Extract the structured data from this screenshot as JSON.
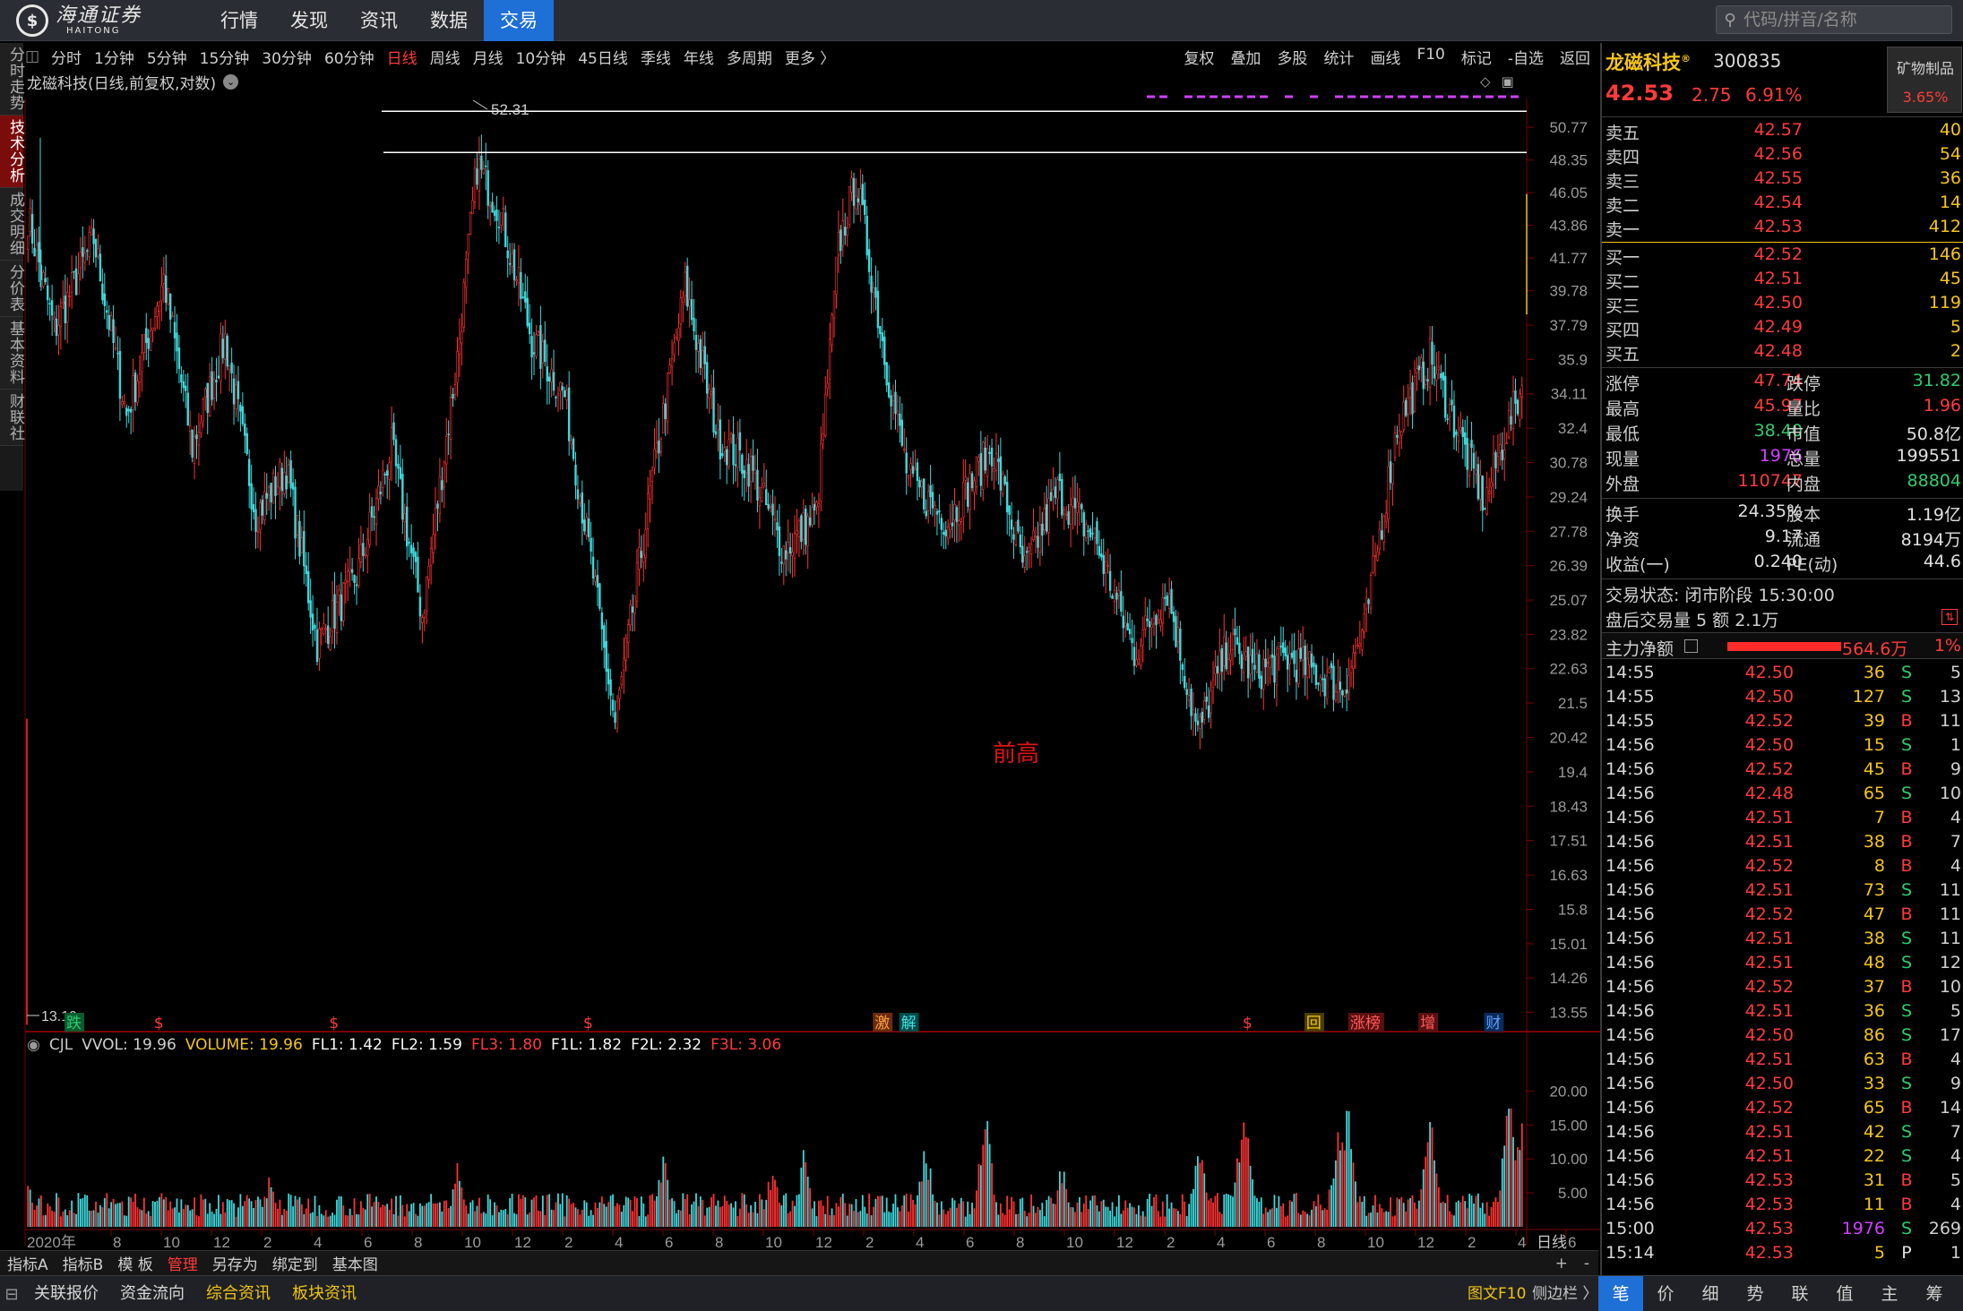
{
  "app": {
    "logo_text": "海通证券",
    "logo_sub": "HAITONG",
    "menu": [
      "行情",
      "发现",
      "资讯",
      "数据",
      "交易"
    ],
    "menu_active": 4,
    "search_placeholder": "代码/拼音/名称"
  },
  "left_tabs": [
    "分时走势",
    "技术分析",
    "成交明细",
    "分价表",
    "基本资料",
    "财联社"
  ],
  "left_tab_active": 1,
  "periods": [
    "分时",
    "1分钟",
    "5分钟",
    "15分钟",
    "30分钟",
    "60分钟",
    "日线",
    "周线",
    "月线",
    "10分钟",
    "45日线",
    "季线",
    "年线",
    "多周期",
    "更多 〉"
  ],
  "period_active": 6,
  "toolbar_right": [
    "复权",
    "叠加",
    "多股",
    "统计",
    "画线",
    "F10",
    "标记",
    "-自选",
    "返回"
  ],
  "chart_title": "龙磁科技(日线,前复权,对数)",
  "chart_tools": [
    "◇",
    "▣"
  ],
  "indicator": {
    "name": "CJL",
    "items": [
      {
        "label": "VVOL: 19.96",
        "color": "#d0d0d0"
      },
      {
        "label": "VOLUME: 19.96",
        "color": "#f5c518"
      },
      {
        "label": "FL1: 1.42",
        "color": "#f5f5f5"
      },
      {
        "label": "FL2: 1.59",
        "color": "#f5f5f5"
      },
      {
        "label": "FL3: 1.80",
        "color": "#ff3b3b"
      },
      {
        "label": "F1L: 1.82",
        "color": "#f5f5f5"
      },
      {
        "label": "F2L: 2.32",
        "color": "#f5f5f5"
      },
      {
        "label": "F3L: 3.06",
        "color": "#ff3b3b"
      }
    ]
  },
  "xaxis_label": "日线",
  "bottom_tools": [
    "指标A",
    "指标B",
    "模 板",
    "管理",
    "另存为",
    "绑定到",
    "基本图"
  ],
  "bottom_tools_active": 3,
  "bottom_tools_right": [
    "+",
    "-"
  ],
  "bottom_tabs": [
    "关联报价",
    "资金流向",
    "综合资讯",
    "板块资讯"
  ],
  "bottom_tabs_yellow": [
    2,
    3
  ],
  "f10_label": "图文F10",
  "sidebar_label": "侧边栏 〉",
  "right_tabs": [
    "笔",
    "价",
    "细",
    "势",
    "联",
    "值",
    "主",
    "筹"
  ],
  "right_tab_active": 0,
  "chart_data": {
    "type": "candlestick",
    "title": "龙磁科技(日线,前复权,对数)",
    "y_scale": "log",
    "ylim": [
      13.2,
      53.0
    ],
    "y_ticks": [
      50.77,
      48.35,
      46.05,
      43.86,
      41.77,
      39.78,
      37.79,
      35.9,
      34.11,
      32.4,
      30.78,
      29.24,
      27.78,
      26.39,
      25.07,
      23.82,
      22.63,
      21.5,
      20.42,
      19.4,
      18.43,
      17.51,
      16.63,
      15.8,
      15.01,
      14.26,
      13.55
    ],
    "x_ticks": [
      "2020年",
      "8",
      "10",
      "12",
      "2",
      "4",
      "6",
      "8",
      "10",
      "12",
      "2",
      "4",
      "6",
      "8",
      "10",
      "12",
      "2",
      "4",
      "6",
      "8",
      "10",
      "12",
      "2",
      "4",
      "6",
      "8",
      "10",
      "12",
      "2",
      "4",
      "6"
    ],
    "high_label": "52.31",
    "low_label": "13.19",
    "annotation": "前高",
    "hlines": [
      52.0,
      48.9
    ],
    "price_path": [
      [
        0,
        44.5
      ],
      [
        12,
        37.5
      ],
      [
        30,
        43.0
      ],
      [
        45,
        33.0
      ],
      [
        62,
        40.5
      ],
      [
        75,
        31.5
      ],
      [
        90,
        37.0
      ],
      [
        104,
        28.5
      ],
      [
        118,
        30.5
      ],
      [
        132,
        23.5
      ],
      [
        150,
        26.0
      ],
      [
        166,
        31.5
      ],
      [
        180,
        24.5
      ],
      [
        196,
        36.0
      ],
      [
        205,
        48.0
      ],
      [
        215,
        45.0
      ],
      [
        230,
        37.0
      ],
      [
        245,
        34.0
      ],
      [
        258,
        26.0
      ],
      [
        268,
        20.8
      ],
      [
        285,
        30.0
      ],
      [
        300,
        40.0
      ],
      [
        315,
        32.0
      ],
      [
        330,
        30.5
      ],
      [
        345,
        27.0
      ],
      [
        360,
        28.5
      ],
      [
        370,
        42.5
      ],
      [
        378,
        47.0
      ],
      [
        392,
        35.5
      ],
      [
        402,
        30.0
      ],
      [
        420,
        28.2
      ],
      [
        440,
        31.5
      ],
      [
        455,
        26.2
      ],
      [
        470,
        29.5
      ],
      [
        487,
        27.5
      ],
      [
        505,
        23.2
      ],
      [
        520,
        25.5
      ],
      [
        534,
        20.5
      ],
      [
        548,
        23.5
      ],
      [
        560,
        22.5
      ],
      [
        575,
        23.0
      ],
      [
        588,
        22.5
      ],
      [
        600,
        22.0
      ],
      [
        610,
        24.0
      ],
      [
        625,
        32.5
      ],
      [
        640,
        36.0
      ],
      [
        652,
        32.5
      ],
      [
        665,
        29.0
      ],
      [
        674,
        32.0
      ],
      [
        682,
        34.5
      ]
    ],
    "volume_axis": [
      20.0,
      15.0,
      10.0,
      5.0
    ],
    "volume_spikes": [
      [
        0,
        7.5
      ],
      [
        60,
        6.5
      ],
      [
        110,
        8.0
      ],
      [
        196,
        10.0
      ],
      [
        290,
        12.0
      ],
      [
        340,
        10.0
      ],
      [
        354,
        11.5
      ],
      [
        410,
        13.5
      ],
      [
        437,
        19.0
      ],
      [
        472,
        10.0
      ],
      [
        535,
        14.0
      ],
      [
        555,
        22.0
      ],
      [
        598,
        17.0
      ],
      [
        602,
        22.5
      ],
      [
        640,
        18.0
      ],
      [
        676,
        21.0
      ],
      [
        682,
        18.5
      ]
    ],
    "markers": [
      {
        "idx": 18,
        "label": "跌",
        "bg": "#0b5b2e",
        "color": "#2ecc71"
      },
      {
        "idx": 58,
        "label": "$",
        "bg": "",
        "color": "#ff3b3b"
      },
      {
        "idx": 138,
        "label": "$",
        "bg": "",
        "color": "#ff3b3b"
      },
      {
        "idx": 254,
        "label": "$",
        "bg": "",
        "color": "#ff3b3b"
      },
      {
        "idx": 387,
        "label": "激",
        "bg": "#6b2b10",
        "color": "#ffa040"
      },
      {
        "idx": 399,
        "label": "解",
        "bg": "#004a4a",
        "color": "#40e0e0"
      },
      {
        "idx": 555,
        "label": "$",
        "bg": "",
        "color": "#ff3b3b"
      },
      {
        "idx": 584,
        "label": "回",
        "bg": "#4a3c00",
        "color": "#f5c518"
      },
      {
        "idx": 604,
        "label": "涨榜",
        "bg": "#5a1010",
        "color": "#ff5a5a"
      },
      {
        "idx": 636,
        "label": "增",
        "bg": "#5a1010",
        "color": "#ff5a5a"
      },
      {
        "idx": 666,
        "label": "财",
        "bg": "#0a2a5a",
        "color": "#5aa0ff"
      }
    ]
  },
  "quote": {
    "name": "龙磁科技",
    "badge": "®",
    "code": "300835",
    "price": "42.53",
    "change": "2.75",
    "change_pct": "6.91%",
    "industry": "矿物制品",
    "industry_pct": "3.65%",
    "asks": [
      {
        "label": "卖五",
        "price": "42.57",
        "vol": "40"
      },
      {
        "label": "卖四",
        "price": "42.56",
        "vol": "54"
      },
      {
        "label": "卖三",
        "price": "42.55",
        "vol": "36"
      },
      {
        "label": "卖二",
        "price": "42.54",
        "vol": "14"
      },
      {
        "label": "卖一",
        "price": "42.53",
        "vol": "412"
      }
    ],
    "bids": [
      {
        "label": "买一",
        "price": "42.52",
        "vol": "146"
      },
      {
        "label": "买二",
        "price": "42.51",
        "vol": "45"
      },
      {
        "label": "买三",
        "price": "42.50",
        "vol": "119"
      },
      {
        "label": "买四",
        "price": "42.49",
        "vol": "5"
      },
      {
        "label": "买五",
        "price": "42.48",
        "vol": "2"
      }
    ],
    "stats": [
      {
        "l1": "涨停",
        "v1": "47.74",
        "c1": "#ff3b3b",
        "l2": "跌停",
        "v2": "31.82",
        "c2": "#2ecc71"
      },
      {
        "l1": "最高",
        "v1": "45.97",
        "c1": "#ff3b3b",
        "l2": "量比",
        "v2": "1.96",
        "c2": "#ff3b3b"
      },
      {
        "l1": "最低",
        "v1": "38.40",
        "c1": "#2ecc71",
        "l2": "市值",
        "v2": "50.8亿",
        "c2": "#e0e0e0"
      },
      {
        "l1": "现量",
        "v1": "1976",
        "c1": "#d040ff",
        "l2": "总量",
        "v2": "199551",
        "c2": "#e0e0e0"
      },
      {
        "l1": "外盘",
        "v1": "110747",
        "c1": "#ff3b3b",
        "l2": "内盘",
        "v2": "88804",
        "c2": "#2ecc71"
      }
    ],
    "stats2": [
      {
        "l1": "换手",
        "v1": "24.35%",
        "c1": "#e0e0e0",
        "l2": "股本",
        "v2": "1.19亿",
        "c2": "#e0e0e0"
      },
      {
        "l1": "净资",
        "v1": "9.17",
        "c1": "#e0e0e0",
        "l2": "流通",
        "v2": "8194万",
        "c2": "#e0e0e0"
      },
      {
        "l1": "收益(一)",
        "v1": "0.240",
        "c1": "#e0e0e0",
        "l2": "PE(动)",
        "v2": "44.6",
        "c2": "#e0e0e0"
      }
    ],
    "status": "交易状态: 闭市阶段 15:30:00",
    "after_hours": "盘后交易量 5 额 2.1万",
    "after_icon": "⇅",
    "main_flow_label": "主力净额",
    "main_flow_value": "564.6万",
    "main_flow_pct": "1%",
    "main_flow_fill": 0.55
  },
  "ticks": [
    {
      "t": "14:55",
      "p": "42.50",
      "v": "36",
      "s": "S",
      "n": "5"
    },
    {
      "t": "14:55",
      "p": "42.50",
      "v": "127",
      "s": "S",
      "n": "13"
    },
    {
      "t": "14:55",
      "p": "42.52",
      "v": "39",
      "s": "B",
      "n": "11"
    },
    {
      "t": "14:56",
      "p": "42.50",
      "v": "15",
      "s": "S",
      "n": "1"
    },
    {
      "t": "14:56",
      "p": "42.52",
      "v": "45",
      "s": "B",
      "n": "9"
    },
    {
      "t": "14:56",
      "p": "42.48",
      "v": "65",
      "s": "S",
      "n": "10"
    },
    {
      "t": "14:56",
      "p": "42.51",
      "v": "7",
      "s": "B",
      "n": "4"
    },
    {
      "t": "14:56",
      "p": "42.51",
      "v": "38",
      "s": "B",
      "n": "7"
    },
    {
      "t": "14:56",
      "p": "42.52",
      "v": "8",
      "s": "B",
      "n": "4"
    },
    {
      "t": "14:56",
      "p": "42.51",
      "v": "73",
      "s": "S",
      "n": "11"
    },
    {
      "t": "14:56",
      "p": "42.52",
      "v": "47",
      "s": "B",
      "n": "11"
    },
    {
      "t": "14:56",
      "p": "42.51",
      "v": "38",
      "s": "S",
      "n": "11"
    },
    {
      "t": "14:56",
      "p": "42.51",
      "v": "48",
      "s": "S",
      "n": "12"
    },
    {
      "t": "14:56",
      "p": "42.52",
      "v": "37",
      "s": "B",
      "n": "10"
    },
    {
      "t": "14:56",
      "p": "42.51",
      "v": "36",
      "s": "S",
      "n": "5"
    },
    {
      "t": "14:56",
      "p": "42.50",
      "v": "86",
      "s": "S",
      "n": "17"
    },
    {
      "t": "14:56",
      "p": "42.51",
      "v": "63",
      "s": "B",
      "n": "4"
    },
    {
      "t": "14:56",
      "p": "42.50",
      "v": "33",
      "s": "S",
      "n": "9"
    },
    {
      "t": "14:56",
      "p": "42.52",
      "v": "65",
      "s": "B",
      "n": "14"
    },
    {
      "t": "14:56",
      "p": "42.51",
      "v": "42",
      "s": "S",
      "n": "7"
    },
    {
      "t": "14:56",
      "p": "42.51",
      "v": "22",
      "s": "S",
      "n": "4"
    },
    {
      "t": "14:56",
      "p": "42.53",
      "v": "31",
      "s": "B",
      "n": "5"
    },
    {
      "t": "14:56",
      "p": "42.53",
      "v": "11",
      "s": "B",
      "n": "4"
    },
    {
      "t": "15:00",
      "p": "42.53",
      "v": "1976",
      "s": "S",
      "n": "269"
    },
    {
      "t": "15:14",
      "p": "42.53",
      "v": "5",
      "s": "P",
      "n": "1"
    }
  ]
}
